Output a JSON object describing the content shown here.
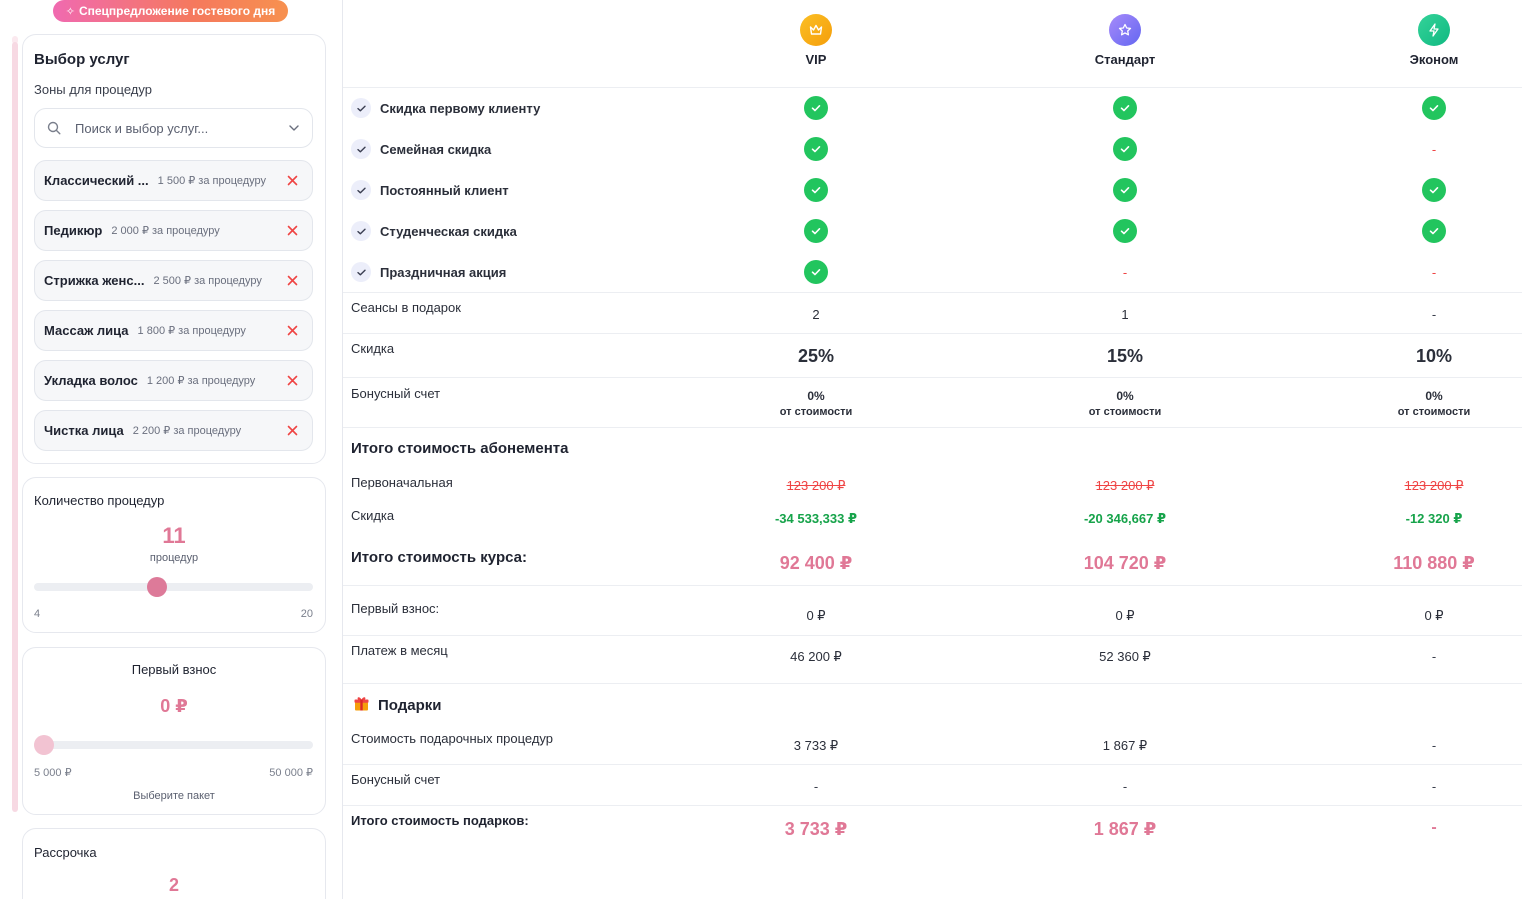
{
  "promo": {
    "label": "Спецпредложение гостевого дня",
    "icon": "sparkles-icon"
  },
  "services_card": {
    "title": "Выбор услуг",
    "zones_label": "Зоны для процедур",
    "search_placeholder": "Поиск и выбор услуг...",
    "items": [
      {
        "name": "Классический ...",
        "price": "1 500 ₽ за процедуру"
      },
      {
        "name": "Педикюр",
        "price": "2 000 ₽ за процедуру"
      },
      {
        "name": "Стрижка женс...",
        "price": "2 500 ₽ за процедуру"
      },
      {
        "name": "Массаж лица",
        "price": "1 800 ₽ за процедуру"
      },
      {
        "name": "Укладка волос",
        "price": "1 200 ₽ за процедуру"
      },
      {
        "name": "Чистка лица",
        "price": "2 200 ₽ за процедуру"
      }
    ]
  },
  "procedures_card": {
    "label": "Количество процедур",
    "value": "11",
    "unit": "процедур",
    "min": "4",
    "max": "20",
    "slider_fraction": 0.44
  },
  "down_payment_card": {
    "label": "Первый взнос",
    "value": "0 ₽",
    "min": "5 000 ₽",
    "max": "50 000 ₽",
    "hint": "Выберите пакет",
    "slider_fraction": 0.0
  },
  "installment_card": {
    "label": "Рассрочка",
    "value": "2"
  },
  "plans": [
    {
      "name": "VIP",
      "icon": "crown-icon",
      "color": "#f5a623"
    },
    {
      "name": "Стандарт",
      "icon": "star-icon",
      "color": "#8b5cf6"
    },
    {
      "name": "Эконом",
      "icon": "lightning-icon",
      "color": "#10b981"
    }
  ],
  "features": [
    {
      "label": "Скидка первому клиенту",
      "values": [
        true,
        true,
        true
      ]
    },
    {
      "label": "Семейная скидка",
      "values": [
        true,
        true,
        false
      ]
    },
    {
      "label": "Постоянный клиент",
      "values": [
        true,
        true,
        true
      ]
    },
    {
      "label": "Студенческая скидка",
      "values": [
        true,
        true,
        true
      ]
    },
    {
      "label": "Праздничная акция",
      "values": [
        true,
        false,
        false
      ]
    }
  ],
  "gift_sessions": {
    "label": "Сеансы в подарок",
    "values": [
      "2",
      "1",
      "-"
    ]
  },
  "discount": {
    "label": "Скидка",
    "values": [
      "25%",
      "15%",
      "10%"
    ]
  },
  "bonus": {
    "label": "Бонусный счет",
    "values": [
      "0%",
      "0%",
      "0%"
    ],
    "suffix": "от стоимости"
  },
  "subscription": {
    "title": "Итого стоимость абонемента",
    "original_label": "Первоначальная",
    "original_values": [
      "123 200 ₽",
      "123 200 ₽",
      "123 200 ₽"
    ],
    "discount_label": "Скидка",
    "discount_values": [
      "-34 533,333 ₽",
      "-20 346,667 ₽",
      "-12 320 ₽"
    ],
    "total_label": "Итого стоимость курса:",
    "total_values": [
      "92 400 ₽",
      "104 720 ₽",
      "110 880 ₽"
    ],
    "first_payment_label": "Первый взнос:",
    "first_payment_values": [
      "0 ₽",
      "0 ₽",
      "0 ₽"
    ],
    "monthly_label": "Платеж в месяц",
    "monthly_values": [
      "46 200 ₽",
      "52 360 ₽",
      "-"
    ]
  },
  "gifts": {
    "title": "Подарки",
    "icon": "gift-icon",
    "cost_label": "Стоимость подарочных процедур",
    "cost_values": [
      "3 733 ₽",
      "1 867 ₽",
      "-"
    ],
    "bonus_label": "Бонусный счет",
    "bonus_values": [
      "-",
      "-",
      "-"
    ],
    "total_label": "Итого стоимость подарков:",
    "total_values": [
      "3 733 ₽",
      "1 867 ₽",
      "-"
    ]
  }
}
